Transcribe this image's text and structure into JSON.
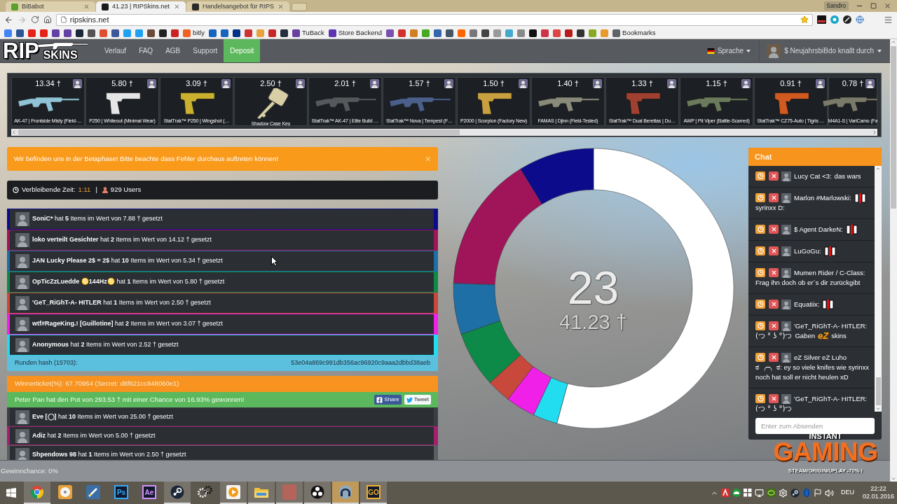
{
  "browser": {
    "tabs": [
      {
        "title": "BiBabot",
        "color": "#5aa02c",
        "selected": false
      },
      {
        "title": "41.23 | RIPSkins.net",
        "color": "#1a1a1a",
        "selected": true
      },
      {
        "title": "Handelsangebot für RIPS",
        "color": "#2a2a2a",
        "selected": false
      }
    ],
    "profile": "Sandro",
    "url": "ripskins.net",
    "bookmarks": [
      {
        "color": "#4285f4"
      },
      {
        "color": "#2b5797"
      },
      {
        "color": "#e62117"
      },
      {
        "color": "#e62117"
      },
      {
        "color": "#6441a5"
      },
      {
        "color": "#6441a5"
      },
      {
        "color": "#1b2838"
      },
      {
        "color": "#555555"
      },
      {
        "color": "#e05030"
      },
      {
        "color": "#3b5998"
      },
      {
        "color": "#1da1f2"
      },
      {
        "color": "#1da1f2"
      },
      {
        "color": "#6b4b3a"
      },
      {
        "color": "#222222"
      },
      {
        "color": "#cc2222"
      },
      {
        "color": "#ee6123",
        "label": "bitly"
      },
      {
        "color": "#1565c0"
      },
      {
        "color": "#1565c0"
      },
      {
        "color": "#003087"
      },
      {
        "color": "#cc3333"
      },
      {
        "color": "#e8a33d"
      },
      {
        "color": "#c62828"
      },
      {
        "color": "#232f3e"
      },
      {
        "color": "#6a3fa0",
        "label": "TuBack"
      },
      {
        "color": "#5e35b1",
        "label": "Store Backend"
      },
      {
        "color": "#7b4fb0"
      },
      {
        "color": "#d32f2f"
      },
      {
        "color": "#d08020"
      },
      {
        "color": "#44aa22"
      },
      {
        "color": "#3366aa"
      },
      {
        "color": "#445566"
      },
      {
        "color": "#ff6600"
      },
      {
        "color": "#777777"
      },
      {
        "color": "#444444"
      },
      {
        "color": "#999999"
      },
      {
        "color": "#44aacc"
      },
      {
        "color": "#888888"
      },
      {
        "color": "#111111"
      },
      {
        "color": "#cc3344"
      },
      {
        "color": "#dd4444"
      },
      {
        "color": "#b71c1c"
      },
      {
        "color": "#333333"
      },
      {
        "color": "#88aa22"
      },
      {
        "color": "#e89a2d"
      },
      {
        "color": "#5f6368",
        "label": "Bookmarks"
      }
    ]
  },
  "site": {
    "logo": {
      "left": "RIP",
      "right": "SKINS"
    },
    "nav": [
      {
        "label": "Verlauf",
        "selected": false
      },
      {
        "label": "FAQ",
        "selected": false
      },
      {
        "label": "AGB",
        "selected": false
      },
      {
        "label": "Support",
        "selected": false
      },
      {
        "label": "Deposit",
        "selected": true
      }
    ],
    "language": "Sprache",
    "user": "$ NeujahrsbiBdo knallt durch"
  },
  "items": [
    {
      "price": "13.34 †",
      "name": "AK-47 | Frontside Misty (Field-…",
      "kind": "rifle",
      "color": "#8fc3d6"
    },
    {
      "price": "5.80 †",
      "name": "P250 | Whiteout (Minimal Wear)",
      "kind": "pistol",
      "color": "#e6e6e6"
    },
    {
      "price": "3.09 †",
      "name": "StatTrak™ P250 | Wingshot (…",
      "kind": "pistol",
      "color": "#c9b02e"
    },
    {
      "price": "2.50 †",
      "name": "Shadow Case Key",
      "kind": "key",
      "color": "#d9cfa6"
    },
    {
      "price": "2.01 †",
      "name": "StatTrak™ AK-47 | Elite Build …",
      "kind": "rifle",
      "color": "#55595c"
    },
    {
      "price": "1.57 †",
      "name": "StatTrak™ Nova | Tempest (F…",
      "kind": "rifle",
      "color": "#4a5f8a"
    },
    {
      "price": "1.50 †",
      "name": "P2000 | Scorpion (Factory New)",
      "kind": "pistol",
      "color": "#c9a040"
    },
    {
      "price": "1.40 †",
      "name": "FAMAS | Djinn (Field-Tested)",
      "kind": "rifle",
      "color": "#8a8a7a"
    },
    {
      "price": "1.33 †",
      "name": "StatTrak™ Dual Berettas | Du…",
      "kind": "pistol",
      "color": "#a04030"
    },
    {
      "price": "1.15 †",
      "name": "AWP | Pit Viper (Battle-Scarred)",
      "kind": "rifle",
      "color": "#6a7a5a"
    },
    {
      "price": "0.91 †",
      "name": "StatTrak™ CZ75-Auto | Tigris …",
      "kind": "pistol",
      "color": "#d05a20"
    },
    {
      "price": "0.78 †",
      "name": "M4A1-S | VariCamo (Fa",
      "kind": "rifle",
      "color": "#7a7a6a"
    }
  ],
  "alert": {
    "text": "Wir befinden uns in der Betaphase! Bitte beachte dass Fehler durchaus auftreten können!",
    "close": "×"
  },
  "timer": {
    "label": "Verbleibende Zeit:",
    "time": "1:11",
    "separator": "|",
    "users": "929 Users"
  },
  "round": {
    "bets": [
      {
        "name": "SoniC*",
        "text": "hat **5** Items im Wert von 7.88 † gesetzt",
        "color": "#0b0b8c"
      },
      {
        "name": "loko verteilt Gesichter",
        "text": "hat **2** Items im Wert von 14.12 † gesetzt",
        "color": "#a0145a"
      },
      {
        "name": "JAN Lucky Please 2$ = 2$",
        "text": "hat **10** Items im Wert von 5.34 † gesetzt",
        "color": "#1d6fa5"
      },
      {
        "name": "OpTicZzLuedde ♋144Hz♋",
        "text": "hat **1** Items im Wert von 5.80 † gesetzt",
        "color": "#0d8a48"
      },
      {
        "name": "'GeT_RiGhT-A- HITLER",
        "text": "hat **1** Items im Wert von 2.50 † gesetzt",
        "color": "#c8483c"
      },
      {
        "name": "wtf#RageKing.! [Guillotine]",
        "text": "hat **2** Items im Wert von 3.07 † gesetzt",
        "color": "#f020e8"
      },
      {
        "name": "Anonymous",
        "text": "hat **2** Items im Wert von 2.52 † gesetzt",
        "color": "#22dcf0"
      }
    ],
    "hash_label": "Runden hash (15703):",
    "hash": "53e04a869c991db356ac96920c9aaa2dbbd38aeb"
  },
  "previous_round": {
    "ticket": "Winnerticket(%): 67.70954 (Secret: d8f621cc848060e1)",
    "result": "Peter Pan hat den Pot von 293.53 † mit einer Chance von 16.93% gewonnen!",
    "share": "Share",
    "tweet": "Tweet",
    "bets": [
      {
        "name": "Eve [◯]",
        "text": "hat **10** Items im Wert von 25.00 † gesetzt",
        "color": "#3b3f45"
      },
      {
        "name": "Adiz",
        "text": "hat **2** Items im Wert von 5.00 † gesetzt",
        "color": "#a3206e"
      },
      {
        "name": "Shpendows 98",
        "text": "hat **1** Items im Wert von 2.50 † gesetzt",
        "color": "#5a5e63"
      }
    ]
  },
  "pot": {
    "items": "23",
    "value": "41.23 †"
  },
  "chat": {
    "title": "Chat",
    "messages": [
      {
        "author": "Lucy Cat <3:",
        "parts": [
          {
            "kind": "text",
            "text": "das wars"
          }
        ]
      },
      {
        "author": "Marlon #Marlowski:",
        "parts": [
          {
            "kind": "rip"
          },
          {
            "kind": "text",
            "text": "syrinxx D:"
          }
        ]
      },
      {
        "author": "$ Agent DarkeN:",
        "parts": [
          {
            "kind": "rip"
          }
        ]
      },
      {
        "author": "LuGoGu:",
        "parts": [
          {
            "kind": "rip"
          }
        ]
      },
      {
        "author": "Mumen Rider / C-Class:",
        "parts": [
          {
            "kind": "text",
            "text": "Frag ihn doch ob er´s dir zurückgibt"
          }
        ]
      },
      {
        "author": "Equatiix:",
        "parts": [
          {
            "kind": "rip"
          }
        ]
      },
      {
        "author": "'GeT_RiGhT-A- HITLER:",
        "parts": [
          {
            "kind": "kaomoji",
            "text": "(つ ° ʖ °)つ"
          },
          {
            "kind": "text",
            "text": "Gaben"
          },
          {
            "kind": "ez",
            "text": "eZ"
          },
          {
            "kind": "text",
            "text": "skins"
          }
        ]
      },
      {
        "author": "eZ Silver eZ Luho",
        "parts": [
          {
            "kind": "text",
            "text": "ಠ ╭╮ ಠ: ey so viele knifes wie syrinxx noch hat soll er nicht heulen xD"
          }
        ]
      },
      {
        "author": "'GeT_RiGhT-A- HITLER:",
        "parts": [
          {
            "kind": "kaomoji",
            "text": "(つ ° ʖ °)つ"
          }
        ]
      }
    ],
    "placeholder": "Enter zum Absenden"
  },
  "status_bar": "Gewinnchance: 0%",
  "ad": {
    "top": "INSTANT",
    "title": "GAMING",
    "tagline": "STEAM/ORIGIN/UPLAY -70% !"
  },
  "taskbar": {
    "apps": [
      {
        "kind": "chrome",
        "open": true,
        "active": false
      },
      {
        "kind": "disc",
        "open": false,
        "active": false
      },
      {
        "kind": "pen",
        "open": false,
        "active": false
      },
      {
        "kind": "tile",
        "label": "Ps",
        "color": "#31a8ff",
        "open": false,
        "active": false
      },
      {
        "kind": "tile",
        "label": "Ae",
        "color": "#d291ff",
        "open": false,
        "active": false
      },
      {
        "kind": "steam",
        "open": true,
        "active": false
      },
      {
        "kind": "gears",
        "open": false,
        "active": false
      },
      {
        "kind": "media",
        "open": true,
        "active": false
      },
      {
        "kind": "folder",
        "open": true,
        "active": false
      },
      {
        "kind": "portrait",
        "open": true,
        "active": false
      },
      {
        "kind": "obs",
        "open": true,
        "active": false
      },
      {
        "kind": "headset",
        "open": true,
        "active": true
      },
      {
        "kind": "tile",
        "label": "GO",
        "color": "#f0b030",
        "open": true,
        "active": false
      }
    ],
    "language": "DEU",
    "time": "22:22",
    "date": "02.01.2016"
  }
}
